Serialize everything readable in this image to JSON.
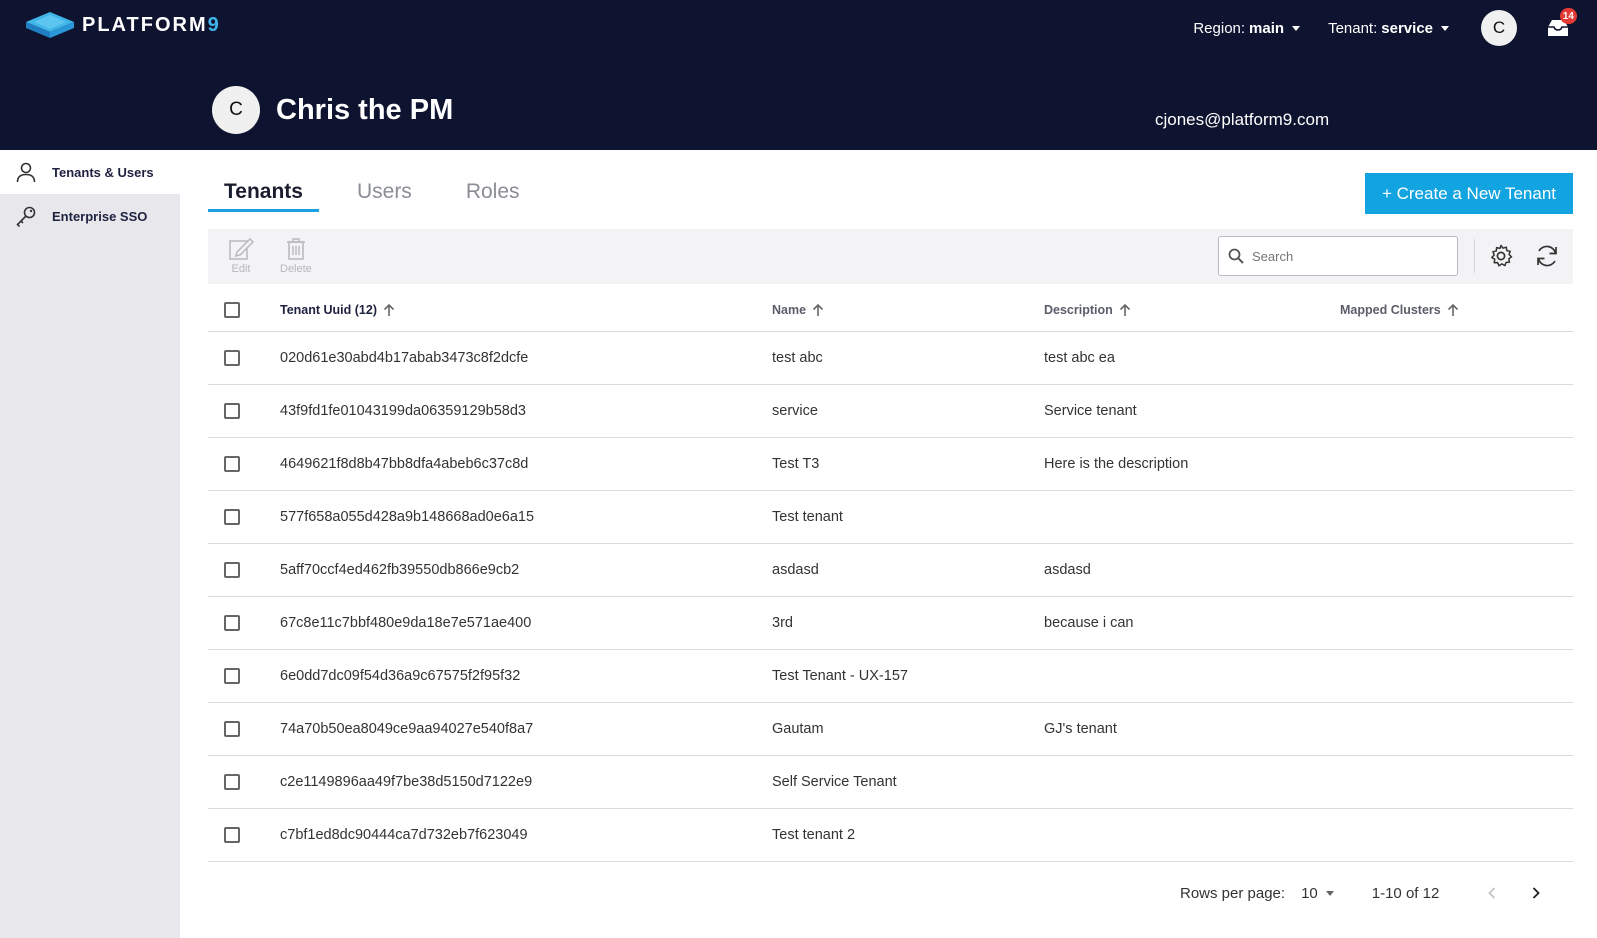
{
  "header": {
    "logo_text": "PLATFORM",
    "logo_suffix": "9",
    "region_label": "Region:",
    "region_value": "main",
    "tenant_label": "Tenant:",
    "tenant_value": "service",
    "user_initial": "C",
    "notification_count": "14"
  },
  "profile": {
    "initial": "C",
    "name": "Chris the PM",
    "email": "cjones@platform9.com"
  },
  "sidebar": {
    "items": [
      {
        "label": "Tenants & Users",
        "icon": "user-icon",
        "active": true
      },
      {
        "label": "Enterprise SSO",
        "icon": "key-icon",
        "active": false
      }
    ]
  },
  "tabs": [
    {
      "label": "Tenants",
      "active": true
    },
    {
      "label": "Users",
      "active": false
    },
    {
      "label": "Roles",
      "active": false
    }
  ],
  "create_button": "+ Create a New Tenant",
  "toolbar": {
    "edit_label": "Edit",
    "delete_label": "Delete",
    "search_placeholder": "Search"
  },
  "table": {
    "columns": {
      "uuid": "Tenant Uuid (12)",
      "name": "Name",
      "description": "Description",
      "mapped_clusters": "Mapped Clusters"
    },
    "rows": [
      {
        "uuid": "020d61e30abd4b17abab3473c8f2dcfe",
        "name": "test abc",
        "description": "test abc ea",
        "mapped_clusters": ""
      },
      {
        "uuid": "43f9fd1fe01043199da06359129b58d3",
        "name": "service",
        "description": "Service tenant",
        "mapped_clusters": ""
      },
      {
        "uuid": "4649621f8d8b47bb8dfa4abeb6c37c8d",
        "name": "Test T3",
        "description": "Here is the description",
        "mapped_clusters": ""
      },
      {
        "uuid": "577f658a055d428a9b148668ad0e6a15",
        "name": "Test tenant",
        "description": "",
        "mapped_clusters": ""
      },
      {
        "uuid": "5aff70ccf4ed462fb39550db866e9cb2",
        "name": "asdasd",
        "description": "asdasd",
        "mapped_clusters": ""
      },
      {
        "uuid": "67c8e11c7bbf480e9da18e7e571ae400",
        "name": "3rd",
        "description": "because i can",
        "mapped_clusters": ""
      },
      {
        "uuid": "6e0dd7dc09f54d36a9c67575f2f95f32",
        "name": "Test Tenant - UX-157",
        "description": "",
        "mapped_clusters": ""
      },
      {
        "uuid": "74a70b50ea8049ce9aa94027e540f8a7",
        "name": "Gautam",
        "description": "GJ's tenant",
        "mapped_clusters": ""
      },
      {
        "uuid": "c2e1149896aa49f7be38d5150d7122e9",
        "name": "Self Service Tenant",
        "description": "",
        "mapped_clusters": ""
      },
      {
        "uuid": "c7bf1ed8dc90444ca7d732eb7f623049",
        "name": "Test tenant 2",
        "description": "",
        "mapped_clusters": ""
      }
    ]
  },
  "pagination": {
    "rows_per_page_label": "Rows per page:",
    "rows_per_page_value": "10",
    "range": "1-10 of 12"
  },
  "colors": {
    "header_bg": "#0e1330",
    "accent": "#11a4e0",
    "sidebar_bg": "#e8e8ec"
  }
}
